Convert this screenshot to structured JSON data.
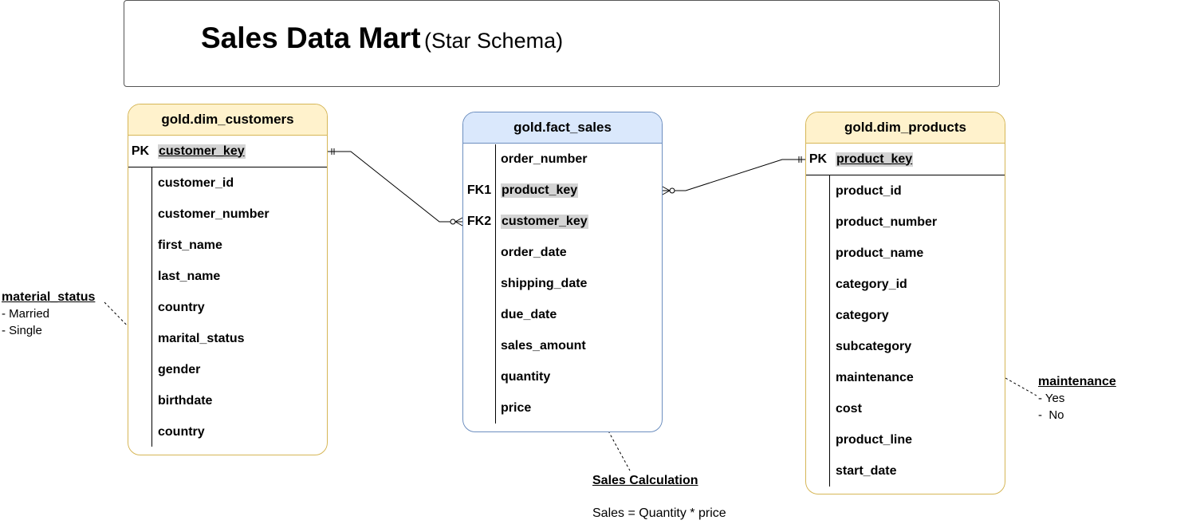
{
  "title": {
    "main": "Sales Data Mart",
    "sub": "(Star Schema)"
  },
  "entities": {
    "dim_customers": {
      "name": "gold.dim_customers",
      "pk": {
        "key": "PK",
        "field": "customer_key"
      },
      "fields": [
        "customer_id",
        "customer_number",
        "first_name",
        "last_name",
        "country",
        "marital_status",
        "gender",
        "birthdate",
        "country"
      ]
    },
    "fact_sales": {
      "name": "gold.fact_sales",
      "rows": [
        {
          "key": "",
          "field": "order_number"
        },
        {
          "key": "FK1",
          "field": "product_key"
        },
        {
          "key": "FK2",
          "field": "customer_key"
        },
        {
          "key": "",
          "field": "order_date"
        },
        {
          "key": "",
          "field": "shipping_date"
        },
        {
          "key": "",
          "field": "due_date"
        },
        {
          "key": "",
          "field": "sales_amount"
        },
        {
          "key": "",
          "field": "quantity"
        },
        {
          "key": "",
          "field": "price"
        }
      ]
    },
    "dim_products": {
      "name": "gold.dim_products",
      "pk": {
        "key": "PK",
        "field": "product_key"
      },
      "fields": [
        "product_id",
        "product_number",
        "product_name",
        "category_id",
        "category",
        "subcategory",
        "maintenance",
        "cost",
        "product_line",
        "start_date"
      ]
    }
  },
  "notes": {
    "material_status": {
      "title": "material_status",
      "lines": [
        "- Married",
        "- Single"
      ]
    },
    "maintenance": {
      "title": "maintenance",
      "lines": [
        "- Yes",
        "-  No"
      ]
    },
    "sales_calc": {
      "title": "Sales Calculation",
      "formula": "Sales = Quantity * price"
    }
  },
  "colors": {
    "dim_fill": "#fff2cc",
    "dim_border": "#d6b656",
    "fact_fill": "#dae8fc",
    "fact_border": "#6c8ebf",
    "key_highlight": "#d4d4d4"
  }
}
